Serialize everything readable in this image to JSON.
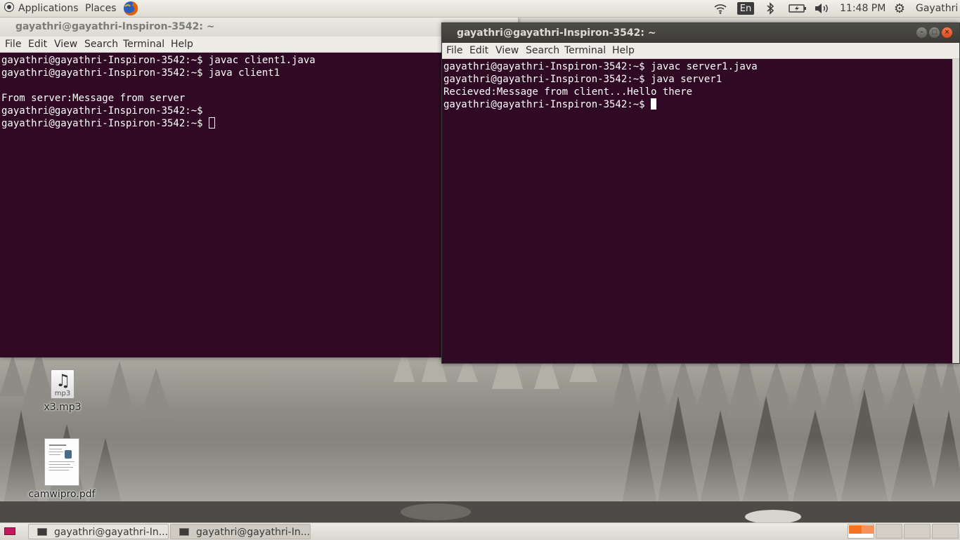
{
  "top_panel": {
    "applications": "Applications",
    "places": "Places",
    "keyboard_layout": "En",
    "clock": "11:48 PM",
    "user": "Gayathri",
    "icons": [
      "gnome-foot-icon",
      "firefox-icon",
      "wifi-icon",
      "bluetooth-icon",
      "battery-icon",
      "volume-icon",
      "settings-gear-icon"
    ]
  },
  "windows": {
    "left": {
      "title": "gayathri@gayathri-Inspiron-3542: ~",
      "menu": [
        "File",
        "Edit",
        "View",
        "Search",
        "Terminal",
        "Help"
      ],
      "lines": [
        "gayathri@gayathri-Inspiron-3542:~$ javac client1.java",
        "gayathri@gayathri-Inspiron-3542:~$ java client1",
        "",
        "From server:Message from server",
        "gayathri@gayathri-Inspiron-3542:~$",
        "gayathri@gayathri-Inspiron-3542:~$ "
      ]
    },
    "right": {
      "title": "gayathri@gayathri-Inspiron-3542: ~",
      "menu": [
        "File",
        "Edit",
        "View",
        "Search",
        "Terminal",
        "Help"
      ],
      "lines": [
        "gayathri@gayathri-Inspiron-3542:~$ javac server1.java",
        "gayathri@gayathri-Inspiron-3542:~$ java server1",
        "Recieved:Message from client...Hello there",
        "gayathri@gayathri-Inspiron-3542:~$ "
      ]
    }
  },
  "desktop_icons": {
    "mp3": {
      "label": "x3.mp3",
      "badge": "mp3"
    },
    "pdf": {
      "label": "camwipro.pdf"
    }
  },
  "taskbar": {
    "tasks": [
      "gayathri@gayathri-In...",
      "gayathri@gayathri-In..."
    ]
  },
  "colors": {
    "terminal_bg": "#300a24",
    "active_titlebar": "#3c3b37",
    "workspace_active": "#f47421"
  }
}
